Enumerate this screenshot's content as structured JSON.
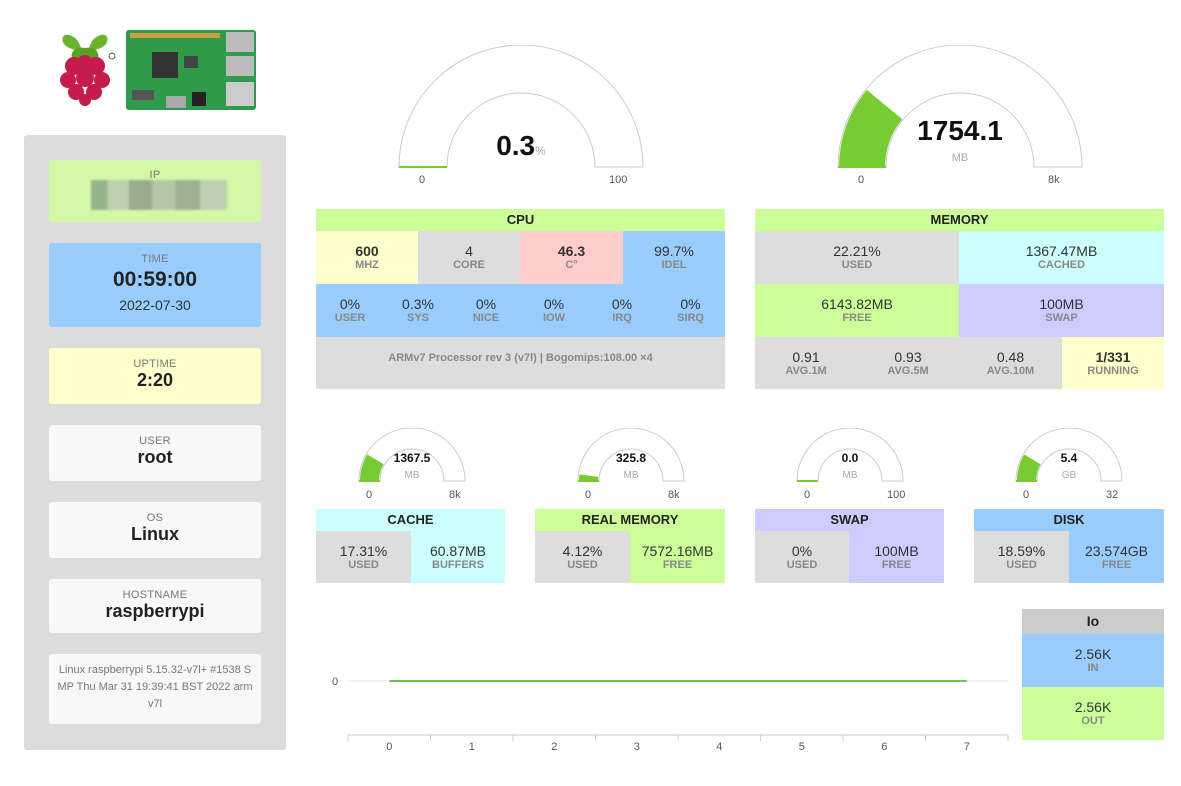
{
  "sidebar": {
    "ip_label": "IP",
    "time_label": "TIME",
    "time_value": "00:59:00",
    "date_value": "2022-07-30",
    "uptime_label": "UPTIME",
    "uptime_value": "2:20",
    "user_label": "USER",
    "user_value": "root",
    "os_label": "OS",
    "os_value": "Linux",
    "hostname_label": "HOSTNAME",
    "hostname_value": "raspberrypi",
    "kernel": "Linux raspberrypi 5.15.32-v7l+ #1538 SMP Thu Mar 31 19:39:41 BST 2022 armv7l"
  },
  "gauges": {
    "cpu": {
      "value": "0.3",
      "unit": "%",
      "min": "0",
      "max": "100",
      "fraction": 0.003
    },
    "memory": {
      "value": "1754.1",
      "unit": "MB",
      "min": "0",
      "max": "8k",
      "fraction": 0.22
    },
    "cache": {
      "value": "1367.5",
      "unit": "MB",
      "min": "0",
      "max": "8k",
      "fraction": 0.17
    },
    "real_memory": {
      "value": "325.8",
      "unit": "MB",
      "min": "0",
      "max": "8k",
      "fraction": 0.04
    },
    "swap": {
      "value": "0.0",
      "unit": "MB",
      "min": "0",
      "max": "100",
      "fraction": 0.0
    },
    "disk": {
      "value": "5.4",
      "unit": "GB",
      "min": "0",
      "max": "32",
      "fraction": 0.17
    }
  },
  "cpu": {
    "title": "CPU",
    "row1": [
      {
        "value": "600",
        "label": "MHz"
      },
      {
        "value": "4",
        "label": "CORE"
      },
      {
        "value": "46.3",
        "label": "C°"
      },
      {
        "value": "99.7%",
        "label": "IDEL"
      }
    ],
    "row2": [
      {
        "value": "0%",
        "label": "USER"
      },
      {
        "value": "0.3%",
        "label": "SYS"
      },
      {
        "value": "0%",
        "label": "NICE"
      },
      {
        "value": "0%",
        "label": "IOW"
      },
      {
        "value": "0%",
        "label": "IRQ"
      },
      {
        "value": "0%",
        "label": "SIRQ"
      }
    ],
    "model": "ARMv7 Processor rev 3 (v7l) | Bogomips:108.00 ×4"
  },
  "memory": {
    "title": "MEMORY",
    "used": {
      "value": "22.21%",
      "label": "USED"
    },
    "cached": {
      "value": "1367.47MB",
      "label": "CACHED"
    },
    "free": {
      "value": "6143.82MB",
      "label": "FREE"
    },
    "swap": {
      "value": "100MB",
      "label": "SWAP"
    },
    "loads": [
      {
        "value": "0.91",
        "label": "AVG.1M"
      },
      {
        "value": "0.93",
        "label": "AVG.5M"
      },
      {
        "value": "0.48",
        "label": "AVG.10M"
      },
      {
        "value": "1/331",
        "label": "RUNNING"
      }
    ]
  },
  "cache_panel": {
    "title": "CACHE",
    "a": {
      "value": "17.31%",
      "label": "USED"
    },
    "b": {
      "value": "60.87MB",
      "label": "BUFFERS"
    }
  },
  "real_panel": {
    "title": "REAL MEMORY",
    "a": {
      "value": "4.12%",
      "label": "USED"
    },
    "b": {
      "value": "7572.16MB",
      "label": "FREE"
    }
  },
  "swap_panel": {
    "title": "SWAP",
    "a": {
      "value": "0%",
      "label": "USED"
    },
    "b": {
      "value": "100MB",
      "label": "FREE"
    }
  },
  "disk_panel": {
    "title": "DISK",
    "a": {
      "value": "18.59%",
      "label": "USED"
    },
    "b": {
      "value": "23.574GB",
      "label": "FREE"
    }
  },
  "io": {
    "title": "Io",
    "in": {
      "value": "2.56K",
      "label": "IN"
    },
    "out": {
      "value": "2.56K",
      "label": "OUT"
    }
  },
  "chart_data": {
    "type": "line",
    "x": [
      0,
      1,
      2,
      3,
      4,
      5,
      6,
      7
    ],
    "series": [
      {
        "values": [
          0,
          0,
          0,
          0,
          0,
          0,
          0,
          0
        ],
        "color": "#66cc44"
      }
    ],
    "yticks": [
      "0"
    ],
    "xlabel": "",
    "ylabel": "",
    "title": "",
    "grid": true
  },
  "colors": {
    "green": "#ccff99",
    "blue": "#99ccff",
    "cyan": "#ccffff",
    "yellow": "#ffffcc",
    "pink": "#ffcccc",
    "purple": "#ccccff",
    "gauge_fill": "#77cc33"
  }
}
